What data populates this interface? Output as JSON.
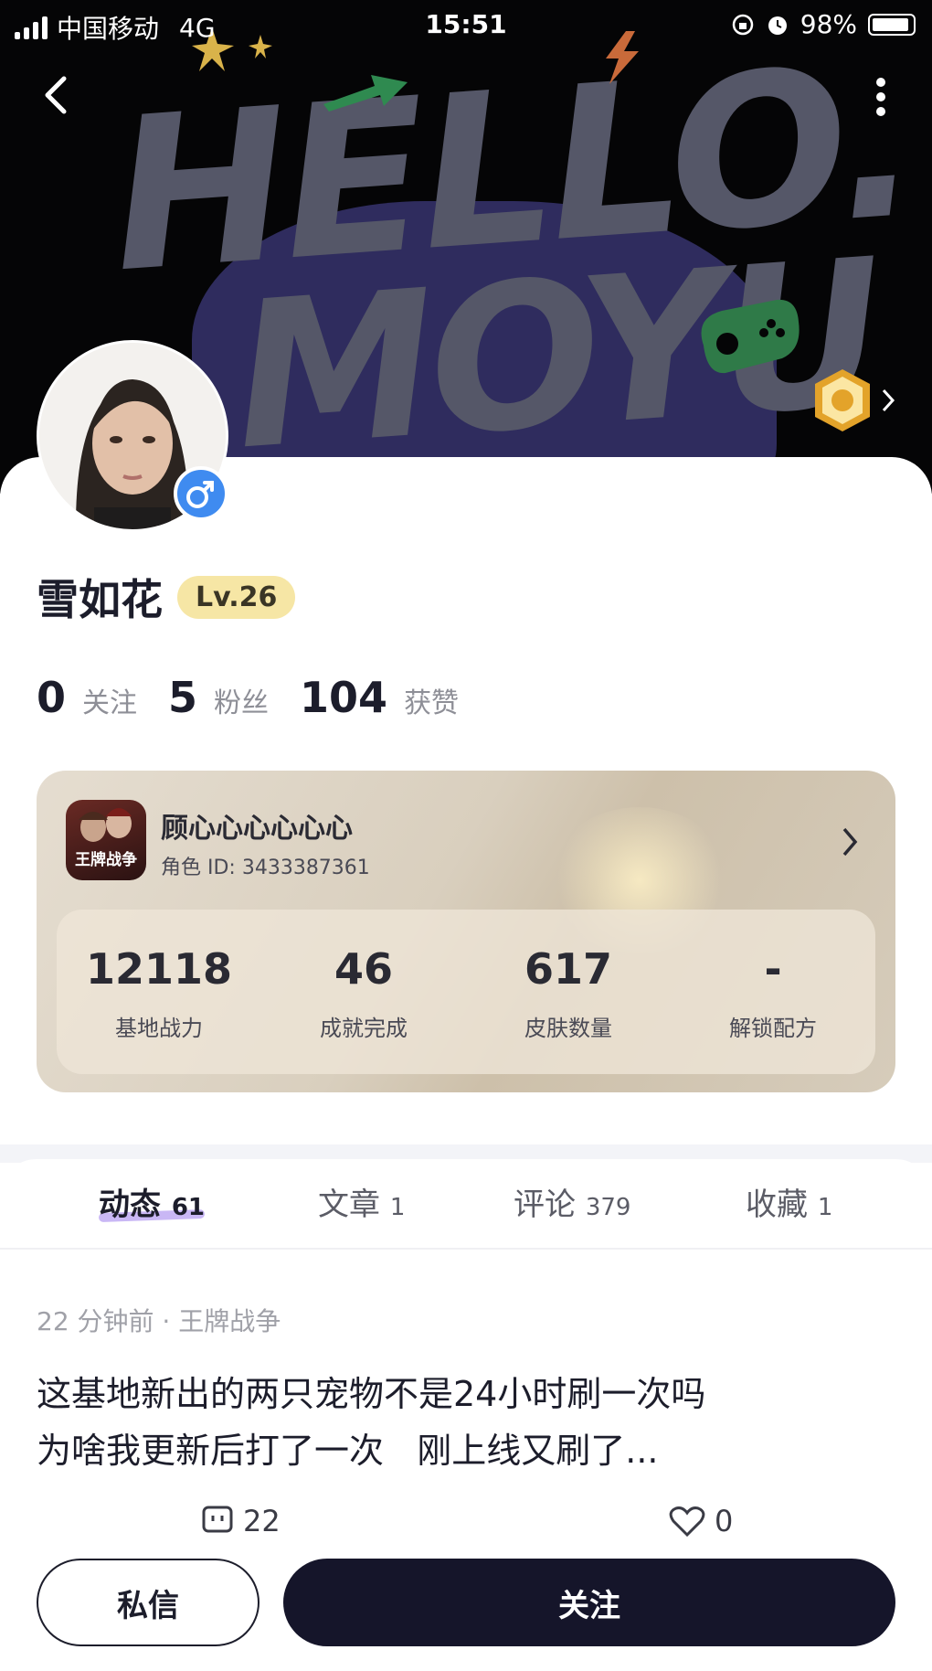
{
  "status_bar": {
    "carrier": "中国移动",
    "network": "4G",
    "time": "15:51",
    "battery": "98%"
  },
  "banner": {
    "line1": "HELLO.",
    "line2": "MOYU"
  },
  "profile": {
    "name": "雪如花",
    "level": "Lv.26",
    "stats": [
      {
        "value": "0",
        "label": "关注"
      },
      {
        "value": "5",
        "label": "粉丝"
      },
      {
        "value": "104",
        "label": "获赞"
      }
    ]
  },
  "game_card": {
    "icon_text": "王牌战争",
    "role_name": "顾心心心心心心",
    "role_id": "角色 ID: 3433387361",
    "stats": [
      {
        "value": "12118",
        "label": "基地战力"
      },
      {
        "value": "46",
        "label": "成就完成"
      },
      {
        "value": "617",
        "label": "皮肤数量"
      },
      {
        "value": "-",
        "label": "解锁配方"
      }
    ]
  },
  "tabs": [
    {
      "label": "动态",
      "count": "61"
    },
    {
      "label": "文章",
      "count": "1"
    },
    {
      "label": "评论",
      "count": "379"
    },
    {
      "label": "收藏",
      "count": "1"
    }
  ],
  "post": {
    "meta": "22 分钟前 · 王牌战争",
    "line1": "这基地新出的两只宠物不是24小时刷一次吗",
    "line2": "为啥我更新后打了一次   刚上线又刷了...",
    "comments": "22",
    "likes": "0"
  },
  "actions": {
    "message": "私信",
    "follow": "关注"
  },
  "colors": {
    "primary_dark": "#15152a",
    "level_badge": "#f6e6a5",
    "gender_blue": "#3f8bf0",
    "tab_highlight": "#c9b7f5"
  },
  "icons": [
    "back-icon",
    "more-icon",
    "medal-icon",
    "gender-male-icon",
    "chevron-right-icon",
    "comment-icon",
    "heart-icon"
  ]
}
